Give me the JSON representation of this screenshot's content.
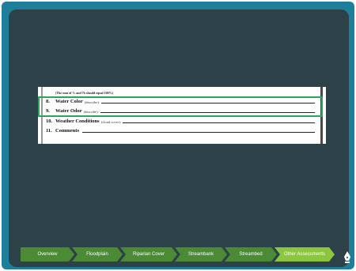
{
  "form": {
    "note": "(The sum of 7c and 7b should equal 100%)",
    "rows": [
      {
        "num": "8.",
        "label": "Water Color",
        "hint": "(describe):"
      },
      {
        "num": "9.",
        "label": "Water Odor",
        "hint": "(describe):"
      },
      {
        "num": "10.",
        "label": "Weather Conditions",
        "hint": "(cloud cover):"
      },
      {
        "num": "11.",
        "label": "Comments",
        "hint": ""
      }
    ]
  },
  "nav": {
    "items": [
      {
        "label": "Overview",
        "active": false
      },
      {
        "label": "Floodplain",
        "active": false
      },
      {
        "label": "Riparian Cover",
        "active": false
      },
      {
        "label": "Streambank",
        "active": false
      },
      {
        "label": "Streambed",
        "active": false
      },
      {
        "label": "Other Assessments",
        "active": true
      }
    ]
  },
  "colors": {
    "frame": "#1f7f9a",
    "panel": "#2c4248",
    "nav_green": "#4c8a36",
    "nav_active": "#8cc63f",
    "highlight": "#2aa55a"
  },
  "icons": {
    "home": "pen-nib-icon"
  }
}
